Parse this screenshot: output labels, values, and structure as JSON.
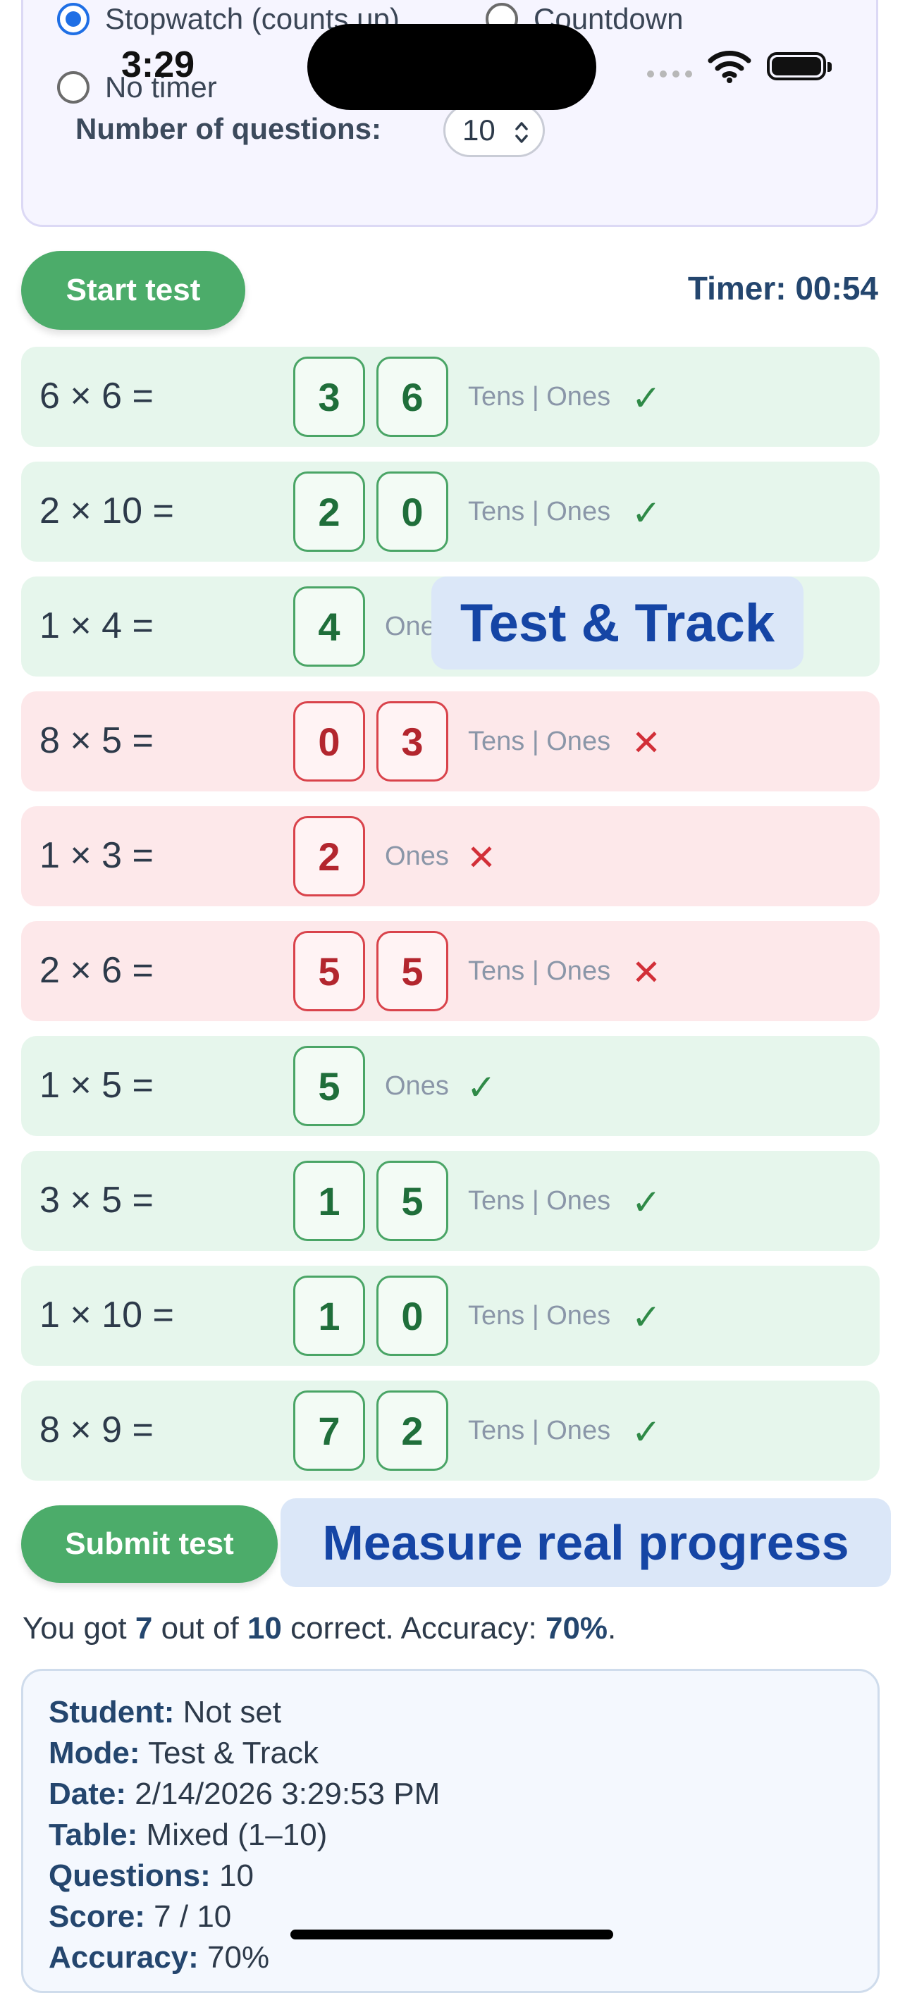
{
  "status_bar": {
    "time": "3:29"
  },
  "settings": {
    "timer_options": [
      {
        "label": "Stopwatch (counts up)",
        "checked": true
      },
      {
        "label": "Countdown",
        "checked": false
      },
      {
        "label": "No timer",
        "checked": false
      }
    ],
    "num_questions_label": "Number of questions:",
    "num_questions_value": "10"
  },
  "controls": {
    "start_label": "Start test",
    "timer_text": "Timer: 00:54",
    "submit_label": "Submit test"
  },
  "questions": [
    {
      "text": "6 × 6 =",
      "digits": [
        "3",
        "6"
      ],
      "place": "Tens | Ones",
      "correct": true
    },
    {
      "text": "2 × 10 =",
      "digits": [
        "2",
        "0"
      ],
      "place": "Tens | Ones",
      "correct": true
    },
    {
      "text": "1 × 4 =",
      "digits": [
        "4"
      ],
      "place": "Ones",
      "correct": true
    },
    {
      "text": "8 × 5 =",
      "digits": [
        "0",
        "3"
      ],
      "place": "Tens | Ones",
      "correct": false
    },
    {
      "text": "1 × 3 =",
      "digits": [
        "2"
      ],
      "place": "Ones",
      "correct": false
    },
    {
      "text": "2 × 6 =",
      "digits": [
        "5",
        "5"
      ],
      "place": "Tens | Ones",
      "correct": false
    },
    {
      "text": "1 × 5 =",
      "digits": [
        "5"
      ],
      "place": "Ones",
      "correct": true
    },
    {
      "text": "3 × 5 =",
      "digits": [
        "1",
        "5"
      ],
      "place": "Tens | Ones",
      "correct": true
    },
    {
      "text": "1 × 10 =",
      "digits": [
        "1",
        "0"
      ],
      "place": "Tens | Ones",
      "correct": true
    },
    {
      "text": "8 × 9 =",
      "digits": [
        "7",
        "2"
      ],
      "place": "Tens | Ones",
      "correct": true
    }
  ],
  "marks": {
    "ok": "✓",
    "bad": "✕"
  },
  "banners": {
    "test_track": "Test & Track",
    "measure": "Measure real progress"
  },
  "result": {
    "prefix": "You got ",
    "score": "7",
    "middle": " out of ",
    "total": "10",
    "suffix1": " correct. Accuracy: ",
    "accuracy": "70%",
    "suffix2": "."
  },
  "summary": [
    {
      "key": "Student:",
      "value": " Not set"
    },
    {
      "key": "Mode:",
      "value": " Test & Track"
    },
    {
      "key": "Date:",
      "value": " 2/14/2026 3:29:53 PM"
    },
    {
      "key": "Table:",
      "value": " Mixed (1–10)"
    },
    {
      "key": "Questions:",
      "value": " 10"
    },
    {
      "key": "Score:",
      "value": " 7 / 10"
    },
    {
      "key": "Accuracy:",
      "value": " 70%"
    }
  ],
  "colors": {
    "accent_green": "#4cac6a",
    "correct_bg": "#e6f6ec",
    "wrong_bg": "#fde8ea",
    "radio_blue": "#1f6fe5",
    "heading_navy": "#24466e",
    "banner_text": "#1545a5"
  }
}
